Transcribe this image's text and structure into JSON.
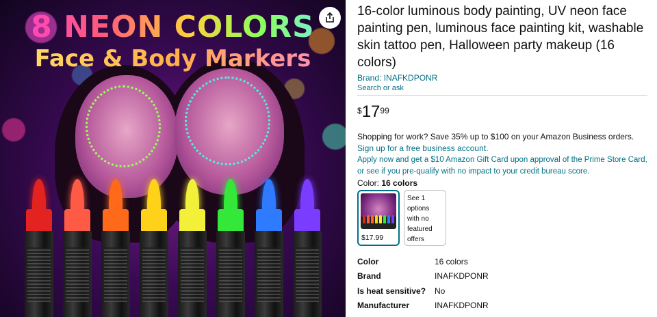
{
  "image": {
    "headline_line1": "8 NEON COLORS",
    "headline_line2": "Face & Body Markers",
    "share_icon": "share-icon",
    "marker_colors": [
      "#e3231f",
      "#ff5a45",
      "#ff6a1a",
      "#ffd21a",
      "#f3f03a",
      "#34e83a",
      "#2f7bff",
      "#7a3dff"
    ]
  },
  "product": {
    "title": "16-color luminous body painting, UV neon face painting pen, luminous face painting kit, washable skin tattoo pen, Halloween party makeup (16 colors)",
    "brand_link": "Brand: INAFKDPONR",
    "search_link": "Search or ask",
    "price": {
      "symbol": "$",
      "whole": "17",
      "fraction": "99"
    },
    "promo_text": "Shopping for work? Save 35% up to $100 on your Amazon Business orders.",
    "promo_link": "Sign up for a free business account.",
    "gift_card_text": "Apply now and get a $10 Amazon Gift Card upon approval of the Prime Store Card, or see if you pre-qualify with no impact to your credit bureau score.",
    "color_label": "Color:",
    "color_value": "16 colors",
    "swatch_price": "$17.99",
    "alt_option_text": "See 1 options with no featured offers"
  },
  "specs": [
    {
      "key": "Color",
      "value": "16 colors"
    },
    {
      "key": "Brand",
      "value": "INAFKDPONR"
    },
    {
      "key": "Is heat sensitive?",
      "value": "No"
    },
    {
      "key": "Manufacturer",
      "value": "INAFKDPONR"
    }
  ],
  "colors": {
    "link": "#007185",
    "swatch_border": "#007185",
    "text": "#0f1111"
  }
}
